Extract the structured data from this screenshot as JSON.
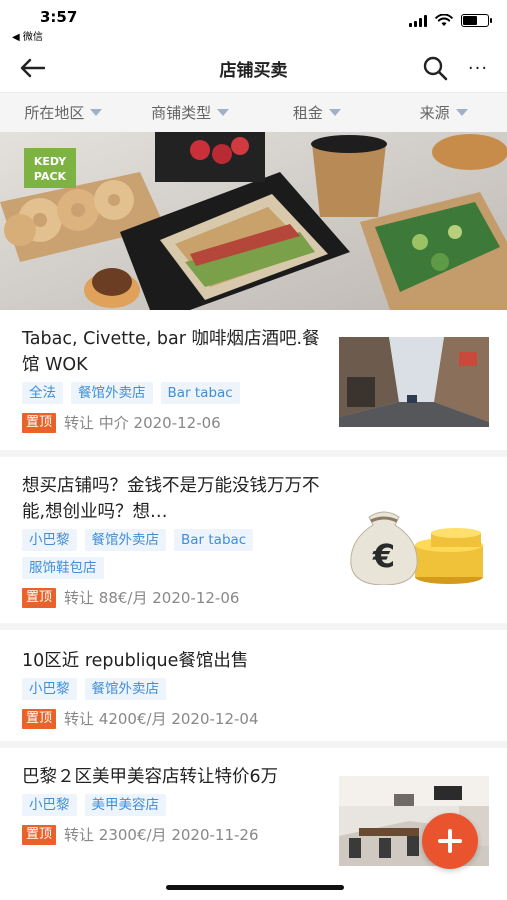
{
  "status_bar": {
    "time": "3:57",
    "back_app": "◀ 微信",
    "battery_level": 0.6
  },
  "nav": {
    "title": "店铺买卖",
    "back_icon": "arrow-left-icon",
    "search_icon": "search-icon",
    "more_icon": "more-icon",
    "more_label": "···"
  },
  "filters": [
    {
      "label": "所在地区"
    },
    {
      "label": "商铺类型"
    },
    {
      "label": "租金"
    },
    {
      "label": "来源"
    }
  ],
  "banner": {
    "brand_line1": "KEDY",
    "brand_line2": "PACK"
  },
  "listings": [
    {
      "title": "Tabac, Civette, bar 咖啡烟店酒吧.餐馆 WOK",
      "tags": [
        "全法",
        "餐馆外卖店",
        "Bar tabac"
      ],
      "pin": "置顶",
      "meta": "转让 中介 2020-12-06"
    },
    {
      "title": "想买店铺吗？金钱不是万能没钱万万不能,想创业吗？想…",
      "tags": [
        "小巴黎",
        "餐馆外卖店",
        "Bar tabac",
        "服饰鞋包店"
      ],
      "pin": "置顶",
      "meta": "转让 88€/月 2020-12-06",
      "euro_symbol": "€"
    },
    {
      "title": "10区近 republique餐馆出售",
      "tags": [
        "小巴黎",
        "餐馆外卖店"
      ],
      "pin": "置顶",
      "meta": "转让 4200€/月 2020-12-04"
    },
    {
      "title": "巴黎２区美甲美容店转让特价6万",
      "tags": [
        "小巴黎",
        "美甲美容店"
      ],
      "pin": "置顶",
      "meta": "转让 2300€/月 2020-11-26"
    }
  ],
  "fab": {
    "icon": "plus-icon"
  },
  "colors": {
    "accent": "#e9542f",
    "pin": "#e8622a",
    "tag_text": "#3f8ed8",
    "tag_bg": "#eef4fb",
    "filter_caret": "#9fb0c8"
  }
}
